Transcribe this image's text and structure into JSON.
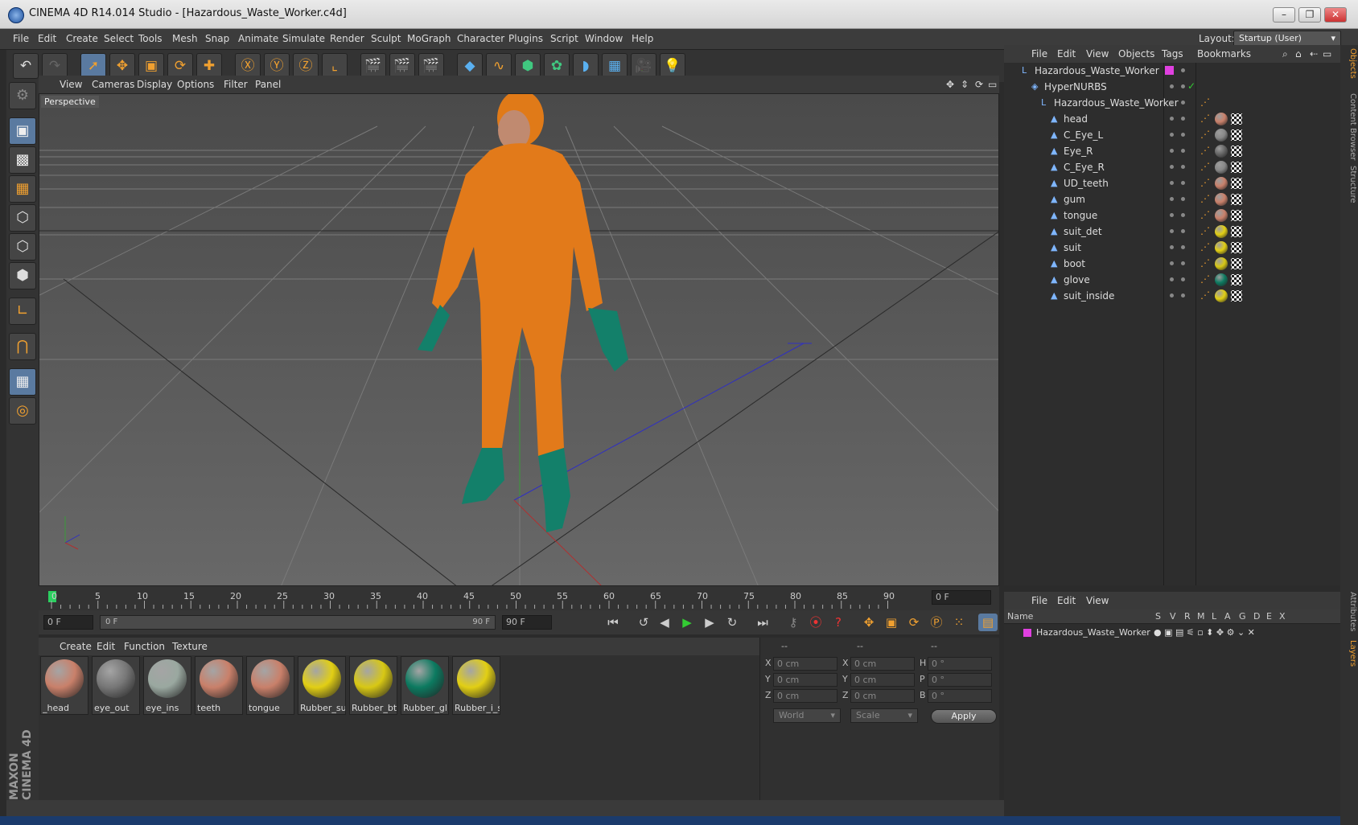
{
  "window": {
    "title": "CINEMA 4D R14.014 Studio - [Hazardous_Waste_Worker.c4d]"
  },
  "menu": [
    "File",
    "Edit",
    "Create",
    "Select",
    "Tools",
    "Mesh",
    "Snap",
    "Animate",
    "Simulate",
    "Render",
    "Sculpt",
    "MoGraph",
    "Character",
    "Plugins",
    "Script",
    "Window",
    "Help"
  ],
  "layout": {
    "label": "Layout:",
    "value": "Startup (User)"
  },
  "viewport": {
    "menu": [
      "View",
      "Cameras",
      "Display",
      "Options",
      "Filter",
      "Panel"
    ],
    "label": "Perspective"
  },
  "timeline": {
    "ticks": [
      "0",
      "5",
      "10",
      "15",
      "20",
      "25",
      "30",
      "35",
      "40",
      "45",
      "50",
      "55",
      "60",
      "65",
      "70",
      "75",
      "80",
      "85",
      "90"
    ],
    "current_frame": "0 F",
    "start_field": "0 F",
    "range_start": "0 F",
    "range_end": "90 F",
    "end_field": "90 F"
  },
  "materials": {
    "menu": [
      "Create",
      "Edit",
      "Function",
      "Texture"
    ],
    "items": [
      {
        "name": "_head",
        "color": "#c9806a"
      },
      {
        "name": "eye_out",
        "color": "#777777"
      },
      {
        "name": "eye_ins",
        "color": "#9aa8a0"
      },
      {
        "name": "teeth",
        "color": "#c9806a"
      },
      {
        "name": "tongue",
        "color": "#c9806a"
      },
      {
        "name": "Rubber_su",
        "color": "#e2cf14"
      },
      {
        "name": "Rubber_bt",
        "color": "#d8c814"
      },
      {
        "name": "Rubber_gl",
        "color": "#0c7a60"
      },
      {
        "name": "Rubber_i_s",
        "color": "#e2cf14"
      }
    ]
  },
  "coords": {
    "headers": [
      "--",
      "--",
      "--"
    ],
    "rows": [
      {
        "a": "X",
        "a_val": "0 cm",
        "b": "X",
        "b_val": "0 cm",
        "c": "H",
        "c_val": "0 °"
      },
      {
        "a": "Y",
        "a_val": "0 cm",
        "b": "Y",
        "b_val": "0 cm",
        "c": "P",
        "c_val": "0 °"
      },
      {
        "a": "Z",
        "a_val": "0 cm",
        "b": "Z",
        "b_val": "0 cm",
        "c": "B",
        "c_val": "0 °"
      }
    ],
    "space": "World",
    "mode": "Scale",
    "apply": "Apply"
  },
  "objects": {
    "menu": [
      "File",
      "Edit",
      "View",
      "Objects",
      "Tags",
      "Bookmarks"
    ],
    "items": [
      {
        "name": "Hazardous_Waste_Worker",
        "indent": 0
      },
      {
        "name": "HyperNURBS",
        "indent": 1
      },
      {
        "name": "Hazardous_Waste_Worker",
        "indent": 2
      },
      {
        "name": "head",
        "indent": 3,
        "mat": "#c9806a"
      },
      {
        "name": "C_Eye_L",
        "indent": 3,
        "mat": "#888888"
      },
      {
        "name": "Eye_R",
        "indent": 3,
        "mat": "#666666"
      },
      {
        "name": "C_Eye_R",
        "indent": 3,
        "mat": "#888888"
      },
      {
        "name": "UD_teeth",
        "indent": 3,
        "mat": "#c9806a"
      },
      {
        "name": "gum",
        "indent": 3,
        "mat": "#c9806a"
      },
      {
        "name": "tongue",
        "indent": 3,
        "mat": "#c9806a"
      },
      {
        "name": "suit_det",
        "indent": 3,
        "mat": "#e2cf14"
      },
      {
        "name": "suit",
        "indent": 3,
        "mat": "#e2cf14"
      },
      {
        "name": "boot",
        "indent": 3,
        "mat": "#d8c814"
      },
      {
        "name": "glove",
        "indent": 3,
        "mat": "#0c7a60"
      },
      {
        "name": "suit_inside",
        "indent": 3,
        "mat": "#e2cf14"
      }
    ]
  },
  "layers": {
    "menu": [
      "File",
      "Edit",
      "View"
    ],
    "headers": [
      "Name",
      "S",
      "V",
      "R",
      "M",
      "L",
      "A",
      "G",
      "D",
      "E",
      "X"
    ],
    "rows": [
      {
        "name": "Hazardous_Waste_Worker",
        "color": "#e040e0"
      }
    ]
  },
  "sidetabs": [
    "Objects",
    "Content Browser",
    "Structure",
    "Attributes",
    "Layers"
  ],
  "brand": "MAXON CINEMA 4D"
}
